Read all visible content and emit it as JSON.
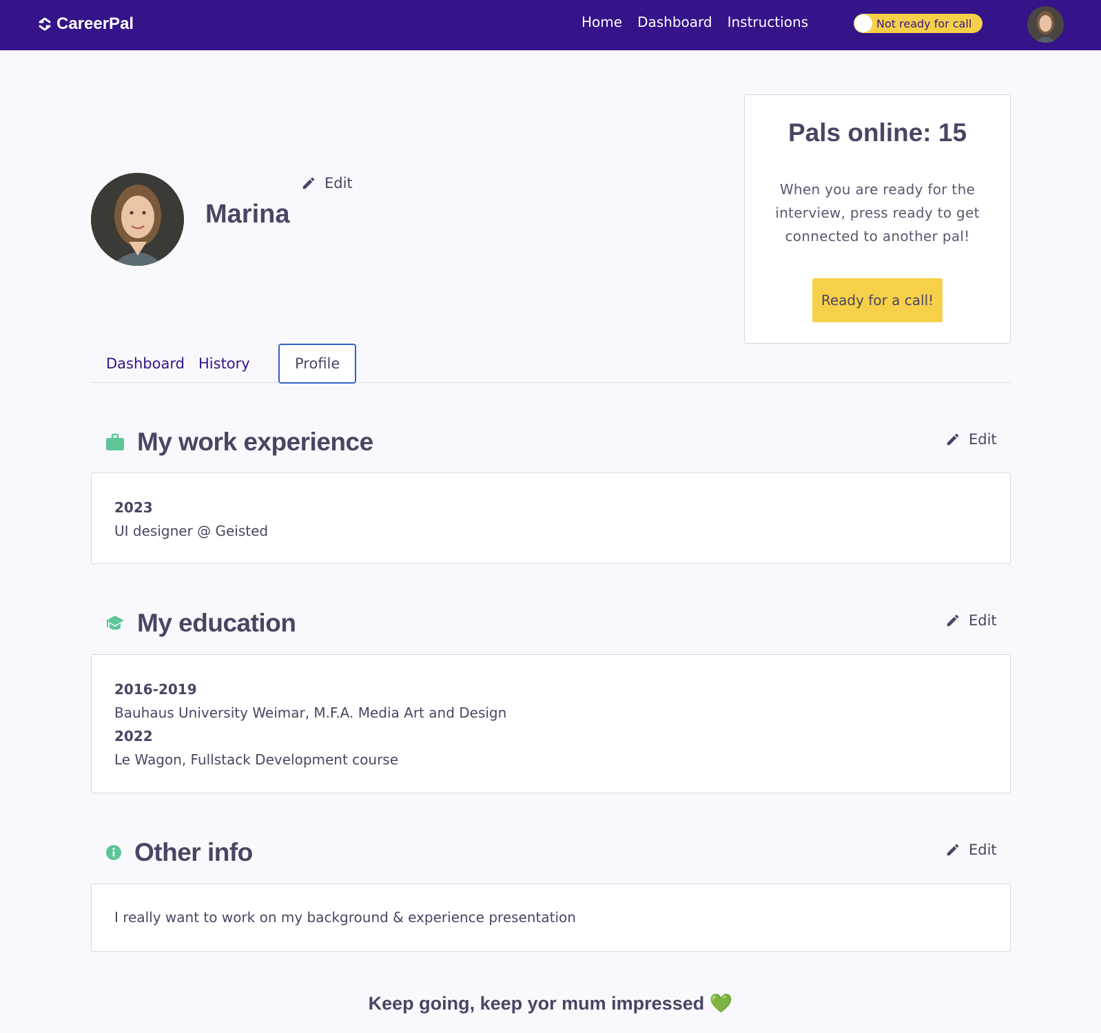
{
  "navbar": {
    "brand": "CareerPal",
    "links": [
      "Home",
      "Dashboard",
      "Instructions"
    ],
    "toggle_label": "Not ready for call",
    "brand_color": "#341488"
  },
  "profile": {
    "name": "Marina",
    "edit_label": "Edit"
  },
  "pals_card": {
    "title": "Pals online: 15",
    "text": "When you are ready for the interview, press ready to get connected to another pal!",
    "button_label": "Ready for a call!",
    "accent": "#f6d049"
  },
  "tabs": [
    {
      "label": "Dashboard",
      "active": false
    },
    {
      "label": "History",
      "active": false
    },
    {
      "label": "Profile",
      "active": true
    }
  ],
  "work": {
    "title": "My work experience",
    "icon": "briefcase-icon",
    "edit_label": "Edit",
    "entries": [
      {
        "year": "2023",
        "desc": "UI designer @ Geisted"
      }
    ]
  },
  "education": {
    "title": "My education",
    "icon": "graduation-cap-icon",
    "edit_label": "Edit",
    "entries": [
      {
        "year": "2016-2019",
        "desc": "Bauhaus University Weimar, M.F.A. Media Art and Design"
      },
      {
        "year": "2022",
        "desc": "Le Wagon, Fullstack Development course"
      }
    ]
  },
  "other": {
    "title": "Other info",
    "icon": "info-icon",
    "edit_label": "Edit",
    "text": "I really want to work on my background & experience presentation"
  },
  "footer": {
    "note": "Keep going, keep yor mum impressed 💚"
  },
  "colors": {
    "section_icon": "#5dc596",
    "tab_active_border": "#2e62c8"
  }
}
